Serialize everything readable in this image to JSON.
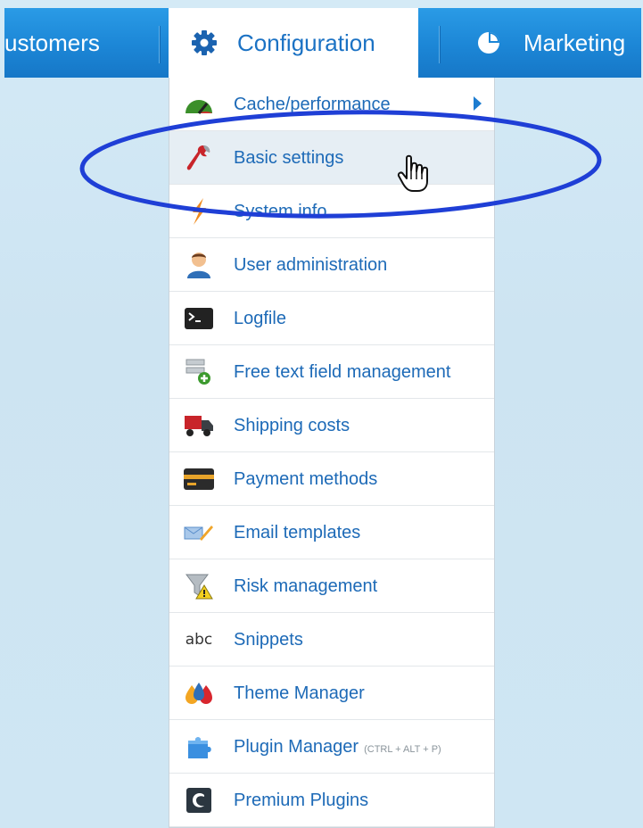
{
  "nav": {
    "items": [
      {
        "label": "ustomers",
        "icon": "customers"
      },
      {
        "label": "Configuration",
        "icon": "gear-icon"
      },
      {
        "label": "Marketing",
        "icon": "pie-chart-icon"
      }
    ]
  },
  "dropdown": {
    "items": [
      {
        "label": "Cache/performance",
        "icon": "speedometer-icon",
        "has_submenu": true
      },
      {
        "label": "Basic settings",
        "icon": "wrench-icon"
      },
      {
        "label": "System info",
        "icon": "lightning-icon"
      },
      {
        "label": "User administration",
        "icon": "user-icon"
      },
      {
        "label": "Logfile",
        "icon": "terminal-icon"
      },
      {
        "label": "Free text field management",
        "icon": "form-add-icon"
      },
      {
        "label": "Shipping costs",
        "icon": "truck-icon"
      },
      {
        "label": "Payment methods",
        "icon": "credit-card-icon"
      },
      {
        "label": "Email templates",
        "icon": "envelope-pencil-icon"
      },
      {
        "label": "Risk management",
        "icon": "filter-warning-icon"
      },
      {
        "label": "Snippets",
        "icon": "abc-icon",
        "icon_text": "abc"
      },
      {
        "label": "Theme Manager",
        "icon": "drops-icon"
      },
      {
        "label": "Plugin Manager",
        "hint": "(CTRL + ALT + P)",
        "icon": "puzzle-icon"
      },
      {
        "label": "Premium Plugins",
        "icon": "shopware-icon"
      }
    ]
  },
  "colors": {
    "menubar": "#1c86d6",
    "link": "#1d6ab7",
    "highlight_ellipse": "#1f3fd6"
  }
}
